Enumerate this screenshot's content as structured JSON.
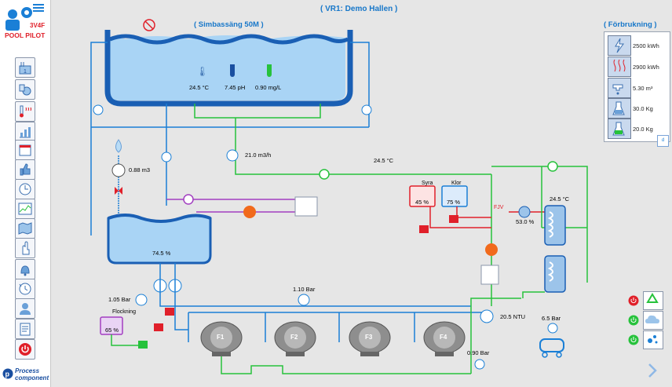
{
  "header": {
    "title": "( VR1: Demo Hallen )"
  },
  "brand": {
    "name": "3V4F",
    "subtitle": "POOL PILOT",
    "vendor_line1": "Process",
    "vendor_line2": "component"
  },
  "pool": {
    "title": "( Simbassäng 50M )",
    "temperature": "24.5 °C",
    "ph": "7.45 pH",
    "chlorine": "0.90 mg/L"
  },
  "consumption": {
    "title": "( Förbrukning )",
    "items": [
      {
        "icon": "lightning-icon",
        "value": "2500 kWh"
      },
      {
        "icon": "heat-icon",
        "value": "2900 kWh"
      },
      {
        "icon": "water-tap-icon",
        "value": "5.30 m³"
      },
      {
        "icon": "acid-flask-icon",
        "value": "30.0 Kg"
      },
      {
        "icon": "chlorine-flask-icon",
        "value": "20.0 Kg"
      }
    ],
    "footer_button": "d"
  },
  "process": {
    "water_volume": "0.88 m3",
    "main_flow": "21.0  m3/h",
    "return_temp": "24.5 °C",
    "balance_tank_level": "74.5 %",
    "syra_label": "Syra",
    "syra_level": "45 %",
    "klor_label": "Klor",
    "klor_level": "75 %",
    "fjv_label": "FJV",
    "fjv_valve": "53.0 %",
    "heat_exchanger_temp": "24.5 °C",
    "pump_pressure_in": "1.05 Bar",
    "filter_pressure_top": "1.10 Bar",
    "filter_pressure_bottom": "0.90 Bar",
    "flock_label": "Flockning",
    "flock_level": "65 %",
    "turbidity": "20.5 NTU",
    "compressor_pressure": "6.5 Bar",
    "filters": [
      "F1",
      "F2",
      "F3",
      "F4"
    ]
  },
  "colors": {
    "pipe_blue": "#1a7fd6",
    "pipe_green": "#27c23c",
    "pipe_purple": "#a23fc0",
    "pipe_red": "#e0202a",
    "title_blue": "#1777c9"
  }
}
